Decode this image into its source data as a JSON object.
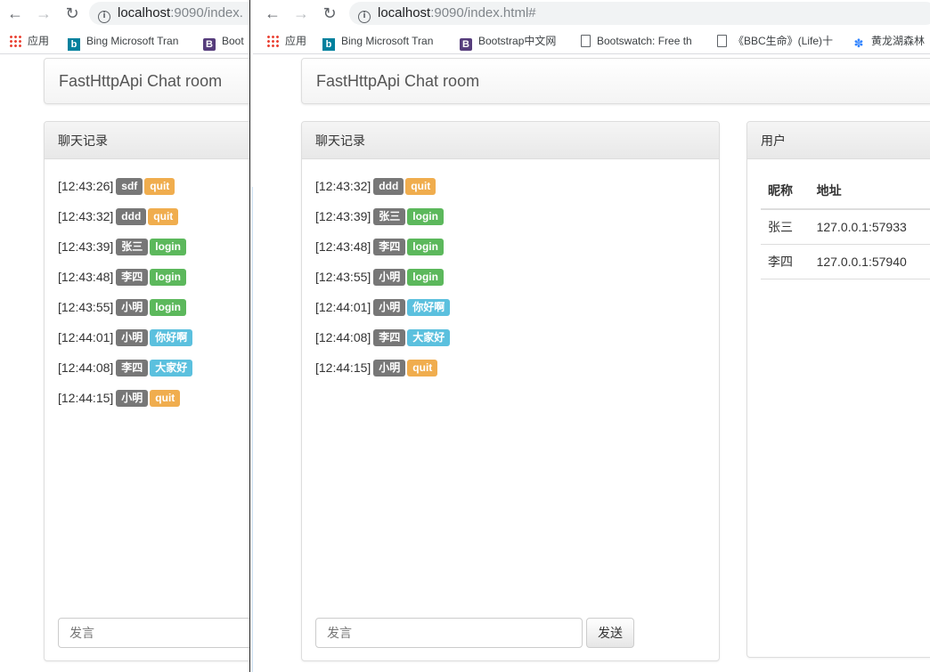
{
  "browser": {
    "url_host": "localhost",
    "url_rest_left": ":9090/index.",
    "url_rest_right": ":9090/index.html#",
    "bookmarks": {
      "apps": "应用",
      "bing": "Bing Microsoft Tran",
      "bootstrap_left": "Boot",
      "bootstrap": "Bootstrap中文网",
      "bootswatch": "Bootswatch: Free th",
      "bbc": "《BBC生命》(Life)十",
      "huanglong": "黄龙湖森林"
    }
  },
  "app": {
    "brand": "FastHttpApi Chat room",
    "chat_panel_title": "聊天记录",
    "users_panel_title": "用户",
    "input_placeholder": "发言",
    "send_label": "发送",
    "users_columns": {
      "nick": "昵称",
      "address": "地址"
    },
    "users": [
      {
        "nick": "张三",
        "address": "127.0.0.1:57933"
      },
      {
        "nick": "李四",
        "address": "127.0.0.1:57940"
      }
    ]
  },
  "left_messages": [
    {
      "time": "[12:43:26]",
      "user": "sdf",
      "text": "quit",
      "kind": "warning"
    },
    {
      "time": "[12:43:32]",
      "user": "ddd",
      "text": "quit",
      "kind": "warning"
    },
    {
      "time": "[12:43:39]",
      "user": "张三",
      "text": "login",
      "kind": "success"
    },
    {
      "time": "[12:43:48]",
      "user": "李四",
      "text": "login",
      "kind": "success"
    },
    {
      "time": "[12:43:55]",
      "user": "小明",
      "text": "login",
      "kind": "success"
    },
    {
      "time": "[12:44:01]",
      "user": "小明",
      "text": "你好啊",
      "kind": "info"
    },
    {
      "time": "[12:44:08]",
      "user": "李四",
      "text": "大家好",
      "kind": "info"
    },
    {
      "time": "[12:44:15]",
      "user": "小明",
      "text": "quit",
      "kind": "warning"
    }
  ],
  "right_messages": [
    {
      "time": "[12:43:32]",
      "user": "ddd",
      "text": "quit",
      "kind": "warning"
    },
    {
      "time": "[12:43:39]",
      "user": "张三",
      "text": "login",
      "kind": "success"
    },
    {
      "time": "[12:43:48]",
      "user": "李四",
      "text": "login",
      "kind": "success"
    },
    {
      "time": "[12:43:55]",
      "user": "小明",
      "text": "login",
      "kind": "success"
    },
    {
      "time": "[12:44:01]",
      "user": "小明",
      "text": "你好啊",
      "kind": "info"
    },
    {
      "time": "[12:44:08]",
      "user": "李四",
      "text": "大家好",
      "kind": "info"
    },
    {
      "time": "[12:44:15]",
      "user": "小明",
      "text": "quit",
      "kind": "warning"
    }
  ],
  "colors": {
    "label_default": "#777777",
    "label_warning": "#f0ad4e",
    "label_success": "#5cb85c",
    "label_info": "#5bc0de"
  }
}
